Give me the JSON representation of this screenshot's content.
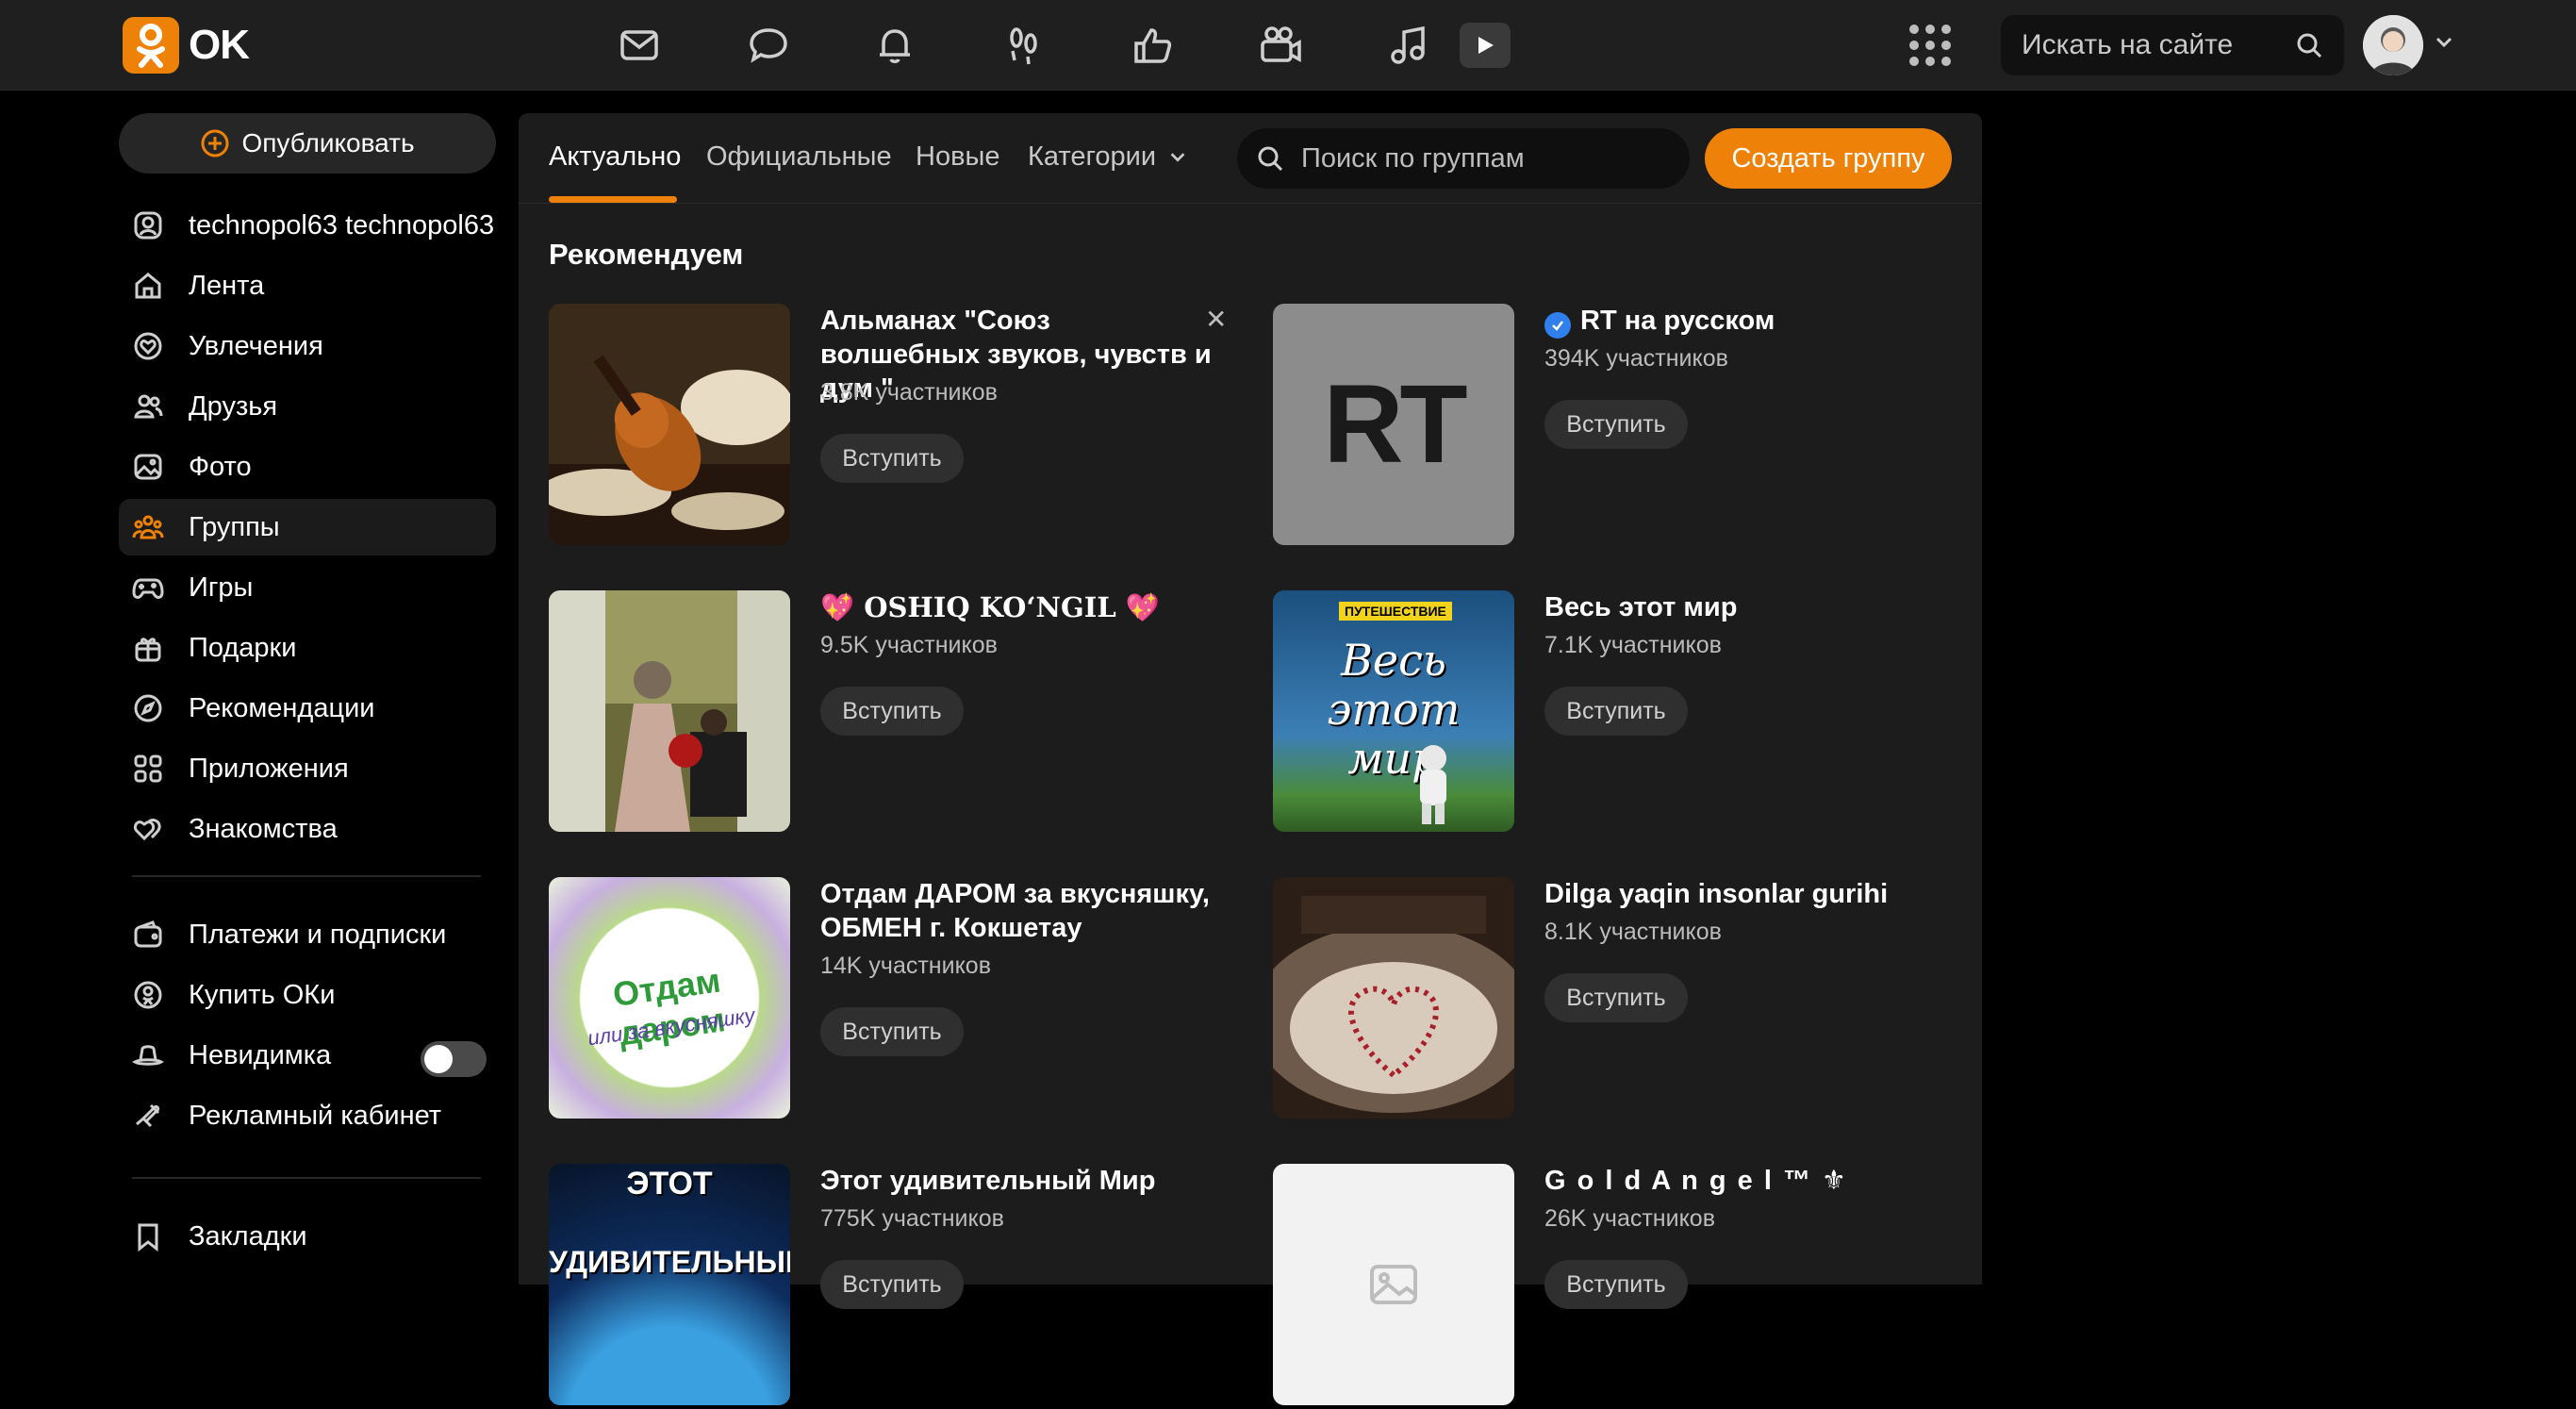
{
  "header": {
    "logo_text": "OK",
    "site_search_placeholder": "Искать на сайте"
  },
  "icons": [
    "mail-icon",
    "chat-icon",
    "bell-icon",
    "footprints-icon",
    "like-icon",
    "video-camera-icon",
    "music-icon",
    "video-play-icon",
    "apps-grid-icon",
    "search-icon",
    "chevron-down-icon"
  ],
  "sidebar": {
    "publish_label": "Опубликовать",
    "items": [
      {
        "label": "technopol63 technopol63",
        "icon": "profile-icon"
      },
      {
        "label": "Лента",
        "icon": "home-icon"
      },
      {
        "label": "Увлечения",
        "icon": "heart-circle-icon"
      },
      {
        "label": "Друзья",
        "icon": "friends-icon"
      },
      {
        "label": "Фото",
        "icon": "photo-icon"
      },
      {
        "label": "Группы",
        "icon": "groups-icon",
        "active": true
      },
      {
        "label": "Игры",
        "icon": "gamepad-icon"
      },
      {
        "label": "Подарки",
        "icon": "gift-icon"
      },
      {
        "label": "Рекомендации",
        "icon": "compass-icon"
      },
      {
        "label": "Приложения",
        "icon": "apps-icon"
      },
      {
        "label": "Знакомства",
        "icon": "hearts-icon"
      },
      {
        "label": "Платежи и подписки",
        "icon": "wallet-icon"
      },
      {
        "label": "Купить ОКи",
        "icon": "coin-icon"
      },
      {
        "label": "Невидимка",
        "icon": "hat-icon",
        "toggle": false
      },
      {
        "label": "Рекламный кабинет",
        "icon": "megaphone-icon"
      },
      {
        "label": "Закладки",
        "icon": "bookmark-icon"
      }
    ]
  },
  "groups_page": {
    "tabs": [
      {
        "label": "Актуально",
        "active": true
      },
      {
        "label": "Официальные"
      },
      {
        "label": "Новые"
      },
      {
        "label": "Категории"
      }
    ],
    "search_placeholder": "Поиск по группам",
    "create_label": "Создать группу",
    "section_title": "Рекомендуем",
    "join_label": "Вступить",
    "cards": [
      {
        "title": "Альманах \"Союз волшебных звуков, чувств и дум \"",
        "members": "3.8K участников",
        "dismissible": true
      },
      {
        "title": "RT на русском",
        "members": "394K участников",
        "verified": true,
        "thumb_text": "RT"
      },
      {
        "title": "💖 OSHIQ KOʻNGIL 💖",
        "members": "9.5K участников"
      },
      {
        "title": "Весь этот мир",
        "members": "7.1K участников",
        "thumb_text": "ПУТЕШЕСТВИЕ",
        "thumb_text2": "Весь этот мир"
      },
      {
        "title": "Отдам ДАРОМ за вкусняшку, ОБМЕН г. Кокшетау",
        "members": "14K участников",
        "thumb_text": "Отдам даром",
        "thumb_text2": "или за вкусняшку"
      },
      {
        "title": "Dilga yaqin insonlar gurihi",
        "members": "8.1K участников"
      },
      {
        "title": "Этот удивительный Мир",
        "members": "775K участников",
        "thumb_text": "ЭТОТ",
        "thumb_text2": "УДИВИТЕЛЬНЫЙ"
      },
      {
        "title": "G o l d A n g e l ™ ⚜",
        "members": "26K участников"
      }
    ]
  },
  "colors": {
    "accent": "#ee8208",
    "topbar": "#1f1f1f",
    "panel": "#1c1c1c",
    "verified": "#2f80ed"
  }
}
